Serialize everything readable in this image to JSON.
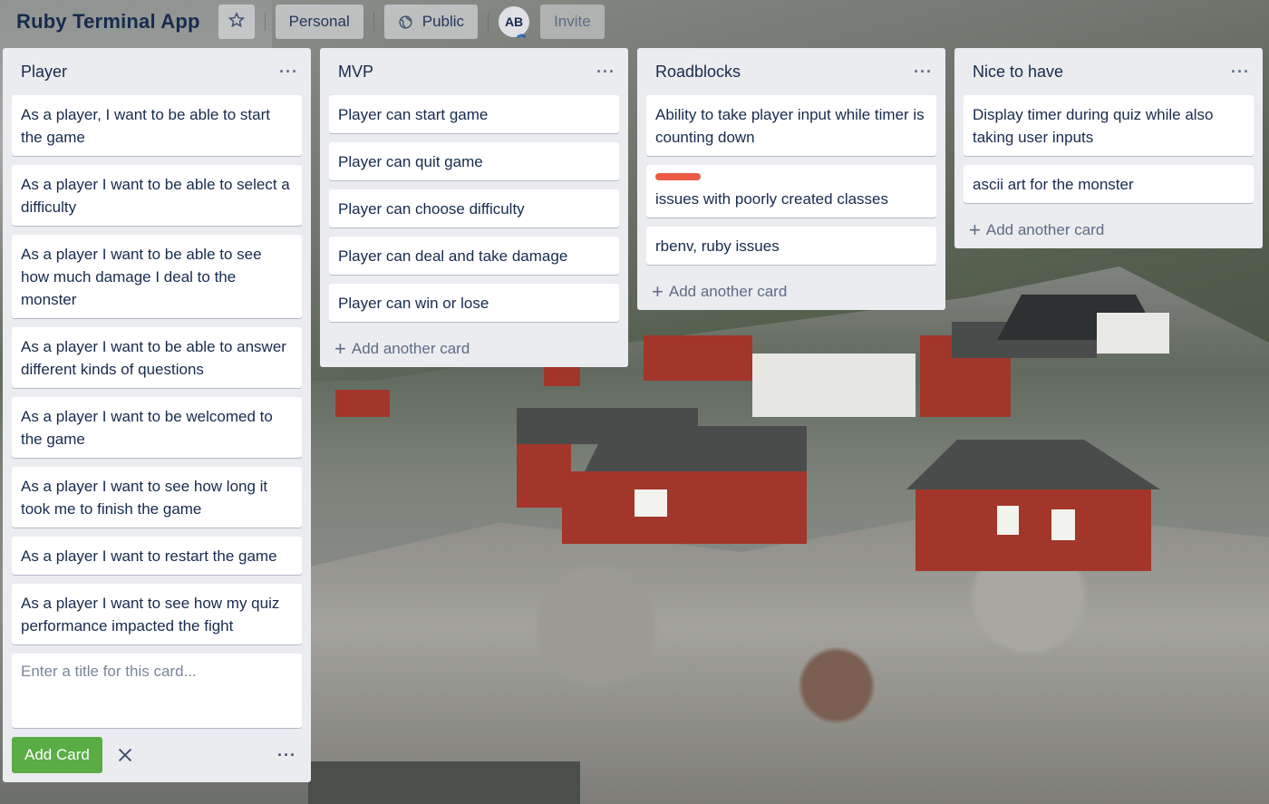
{
  "header": {
    "board_title": "Ruby Terminal App",
    "personal_label": "Personal",
    "public_label": "Public",
    "avatar_initials": "AB",
    "invite_label": "Invite"
  },
  "lists": [
    {
      "title": "Player",
      "cards": [
        "As a player, I want to be able to start the game",
        "As a player I want to be able to select a difficulty",
        "As a player I want to be able to see how much damage I deal to the monster",
        "As a player I want to be able to answer different kinds of questions",
        "As a player I want to be welcomed to the game",
        "As a player I want to see how long it took me to finish the game",
        "As a player I want to restart the game",
        "As a player I want to see how my quiz performance impacted the fight"
      ],
      "composer_placeholder": "Enter a title for this card...",
      "add_card_button": "Add Card"
    },
    {
      "title": "MVP",
      "cards": [
        "Player can start game",
        "Player can quit game",
        "Player can choose difficulty",
        "Player can deal and take damage",
        "Player can win or lose"
      ],
      "add_label": "Add another card"
    },
    {
      "title": "Roadblocks",
      "cards": [
        "Ability to take player input while timer is counting down",
        "issues with poorly created classes",
        "rbenv, ruby issues"
      ],
      "label_color": "#eb5a46",
      "add_label": "Add another card"
    },
    {
      "title": "Nice to have",
      "cards": [
        "Display timer during quiz while also taking user inputs",
        "ascii art for the monster"
      ],
      "add_label": "Add another card"
    }
  ],
  "icons": {
    "star": "star-icon",
    "public": "globe-icon",
    "more": "ellipsis-icon",
    "close": "close-icon",
    "plus": "plus-icon"
  },
  "colors": {
    "list_bg": "#ebecf0",
    "add_button": "#5aac44",
    "text": "#172b4d"
  }
}
